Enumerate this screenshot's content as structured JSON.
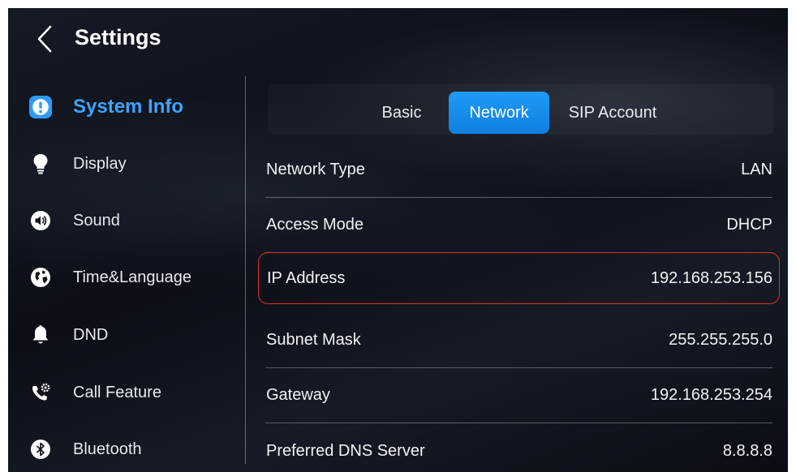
{
  "header": {
    "title": "Settings"
  },
  "sidebar": {
    "items": [
      {
        "label": "System Info",
        "icon": "info-icon"
      },
      {
        "label": "Display",
        "icon": "bulb-icon"
      },
      {
        "label": "Sound",
        "icon": "speaker-icon"
      },
      {
        "label": "Time&Language",
        "icon": "globe-icon"
      },
      {
        "label": "DND",
        "icon": "bell-icon"
      },
      {
        "label": "Call Feature",
        "icon": "phone-gear-icon"
      },
      {
        "label": "Bluetooth",
        "icon": "bluetooth-icon"
      }
    ],
    "active_index": 0
  },
  "tabs": {
    "items": [
      {
        "label": "Basic"
      },
      {
        "label": "Network"
      },
      {
        "label": "SIP Account"
      }
    ],
    "active_index": 1
  },
  "network": {
    "rows": [
      {
        "label": "Network Type",
        "value": "LAN"
      },
      {
        "label": "Access Mode",
        "value": "DHCP"
      },
      {
        "label": "IP Address",
        "value": "192.168.253.156"
      },
      {
        "label": "Subnet Mask",
        "value": "255.255.255.0"
      },
      {
        "label": "Gateway",
        "value": "192.168.253.254"
      },
      {
        "label": "Preferred DNS Server",
        "value": "8.8.8.8"
      }
    ],
    "highlighted_row": 2
  },
  "colors": {
    "accent": "#1e9af7",
    "active_text": "#3fa2ff",
    "highlight_border": "#d8322a",
    "background": "#0b0e15"
  }
}
